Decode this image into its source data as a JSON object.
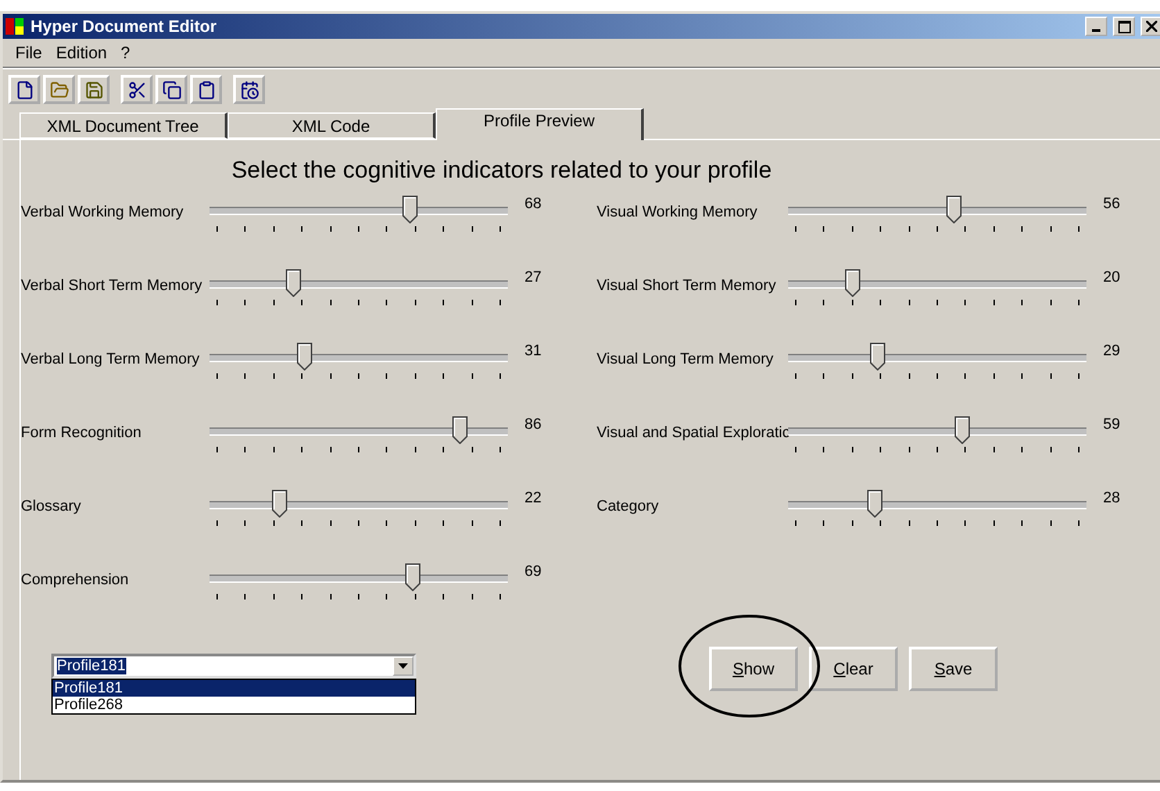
{
  "window": {
    "title": "Hyper Document Editor"
  },
  "menu": [
    "File",
    "Edition",
    "?"
  ],
  "tabs": [
    {
      "label": "XML Document Tree",
      "selected": false
    },
    {
      "label": "XML Code",
      "selected": false
    },
    {
      "label": "Profile Preview",
      "selected": true
    }
  ],
  "heading": "Select the cognitive indicators related to your profile",
  "left_sliders": [
    {
      "name": "Verbal Working Memory",
      "level": 0.68,
      "reading": "68"
    },
    {
      "name": "Verbal Short Term Memory",
      "level": 0.27,
      "reading": "27"
    },
    {
      "name": "Verbal Long Term Memory",
      "level": 0.31,
      "reading": "31"
    },
    {
      "name": "Form Recognition",
      "level": 0.86,
      "reading": "86"
    },
    {
      "name": "Glossary",
      "level": 0.22,
      "reading": "22"
    },
    {
      "name": "Comprehension",
      "level": 0.69,
      "reading": "69"
    }
  ],
  "right_sliders": [
    {
      "name": "Visual Working Memory",
      "level": 0.56,
      "reading": "56"
    },
    {
      "name": "Visual Short Term Memory",
      "level": 0.2,
      "reading": "20"
    },
    {
      "name": "Visual Long Term Memory",
      "level": 0.29,
      "reading": "29"
    },
    {
      "name": "Visual and Spatial Exploratic",
      "level": 0.59,
      "reading": "59"
    },
    {
      "name": "Category",
      "level": 0.28,
      "reading": "28"
    }
  ],
  "profile_combo": {
    "value": "Profile181",
    "options": [
      {
        "label": "Profile181",
        "selected": true
      },
      {
        "label": "Profile268",
        "selected": false
      }
    ]
  },
  "buttons": [
    {
      "label": "Show",
      "circled": true
    },
    {
      "label": "Clear",
      "circled": false
    },
    {
      "label": "Save",
      "circled": false
    }
  ]
}
